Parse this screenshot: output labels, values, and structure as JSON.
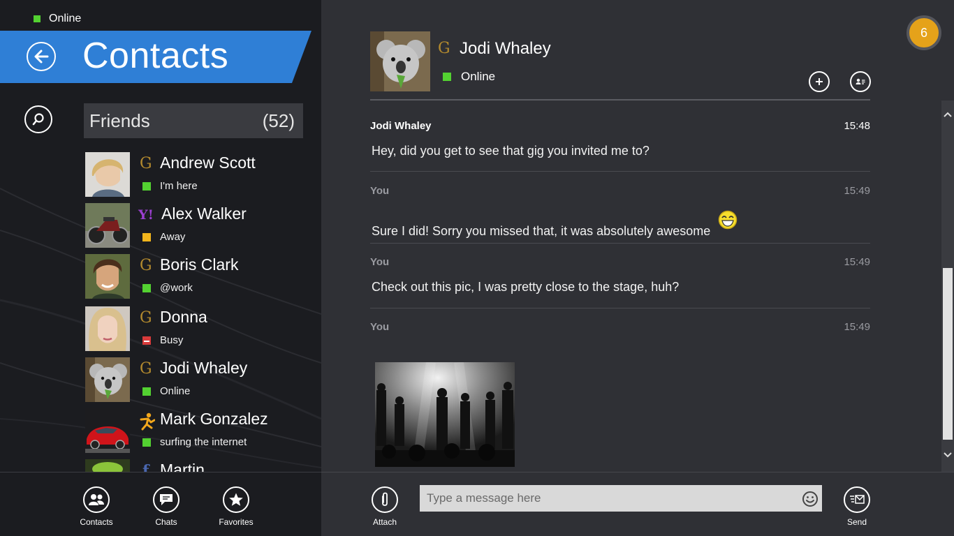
{
  "status": {
    "label": "Online",
    "color": "#53d131"
  },
  "header": {
    "title": "Contacts",
    "accent": "#2f7fd6"
  },
  "group": {
    "name": "Friends",
    "count": "(52)"
  },
  "contacts": [
    {
      "name": "Andrew Scott",
      "service": "G",
      "status_text": "I'm here",
      "status": "online"
    },
    {
      "name": "Alex Walker",
      "service": "Y!",
      "status_text": "Away",
      "status": "away"
    },
    {
      "name": "Boris Clark",
      "service": "G",
      "status_text": "@work",
      "status": "online"
    },
    {
      "name": "Donna",
      "service": "G",
      "status_text": "Busy",
      "status": "busy"
    },
    {
      "name": "Jodi Whaley",
      "service": "G",
      "status_text": "Online",
      "status": "online"
    },
    {
      "name": "Mark Gonzalez",
      "service": "aim",
      "status_text": "surfing the internet",
      "status": "online"
    },
    {
      "name": "Martin",
      "service": "f",
      "status_text": "",
      "status": "online"
    }
  ],
  "bottom_nav": {
    "contacts": "Contacts",
    "chats": "Chats",
    "favorites": "Favorites"
  },
  "chat": {
    "contact_name": "Jodi Whaley",
    "service": "G",
    "status": "Online",
    "notification_count": "6",
    "messages": [
      {
        "sender": "Jodi Whaley",
        "time": "15:48",
        "text": "Hey, did you get to see that gig you invited me to?"
      },
      {
        "sender": "You",
        "time": "15:49",
        "text": "Sure I did! Sorry you missed that, it was absolutely awesome"
      },
      {
        "sender": "You",
        "time": "15:49",
        "text": "Check out this pic, I was pretty close to the stage, huh?"
      },
      {
        "sender": "You",
        "time": "15:49",
        "text": ""
      }
    ]
  },
  "composer": {
    "placeholder": "Type a message here",
    "attach": "Attach",
    "send": "Send"
  }
}
